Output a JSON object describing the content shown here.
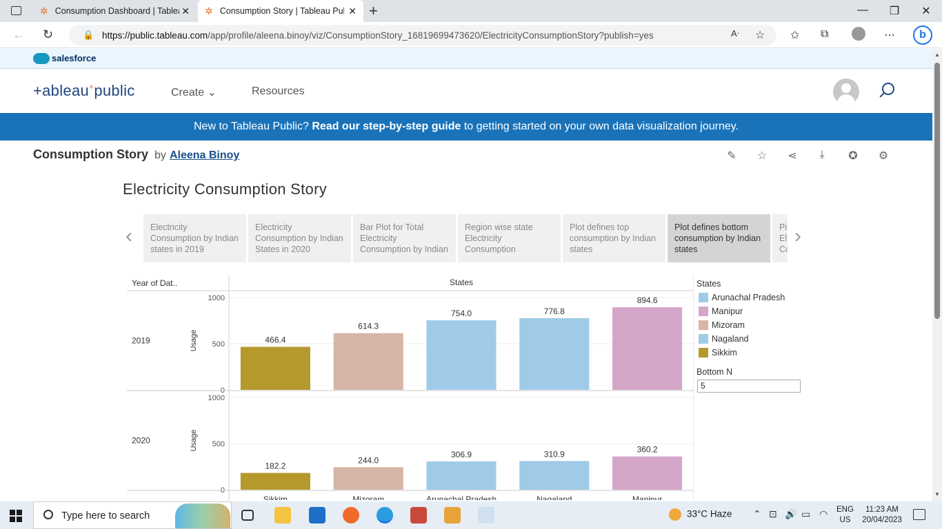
{
  "browser": {
    "tabs": [
      {
        "title": "Consumption Dashboard | Tablea"
      },
      {
        "title": "Consumption Story | Tableau Pub"
      }
    ],
    "new_tab": "+",
    "url_domain": "https://public.tableau.com",
    "url_path": "/app/profile/aleena.binoy/viz/ConsumptionStory_16819699473620/ElectricityConsumptionStory?publish=yes",
    "minimize": "—",
    "restore": "❐",
    "close": "✕"
  },
  "salesforce": {
    "label": "salesforce"
  },
  "header": {
    "logo_a": "+ableau",
    "logo_plus": "+",
    "logo_b": "public",
    "nav": [
      {
        "label": "Create ⌄"
      },
      {
        "label": "Resources"
      }
    ]
  },
  "banner": {
    "pre": "New to Tableau Public? ",
    "bold": "Read our step-by-step guide",
    "post": " to getting started on your own data visualization journey."
  },
  "viz": {
    "title": "Consumption Story",
    "by": "by",
    "author": "Aleena Binoy",
    "story_title": "Electricity Consumption Story"
  },
  "story_points": [
    {
      "label": "Electricity Consumption by Indian states in 2019"
    },
    {
      "label": "Electricity Consumption by Indian States in 2020"
    },
    {
      "label": "Bar Plot for Total Electricity Consumption by Indian"
    },
    {
      "label": "Region wise state Electricity Consumption"
    },
    {
      "label": "Plot defines top consumption by Indian states"
    },
    {
      "label": "Plot defines bottom consumption by Indian states"
    },
    {
      "label": "Pi El Co"
    }
  ],
  "chart_data": {
    "type": "bar",
    "title": "",
    "row_header": "Year of Dat..",
    "column_header": "States",
    "ylabel": "Usage",
    "ylim": [
      0,
      1000
    ],
    "yticks": [
      0,
      500,
      1000
    ],
    "panels": [
      {
        "year": "2019",
        "categories": [
          "Sikkim",
          "Mizoram",
          "Arunachal Pradesh",
          "Nagaland",
          "Manipur"
        ],
        "values": [
          466.4,
          614.3,
          754.0,
          776.8,
          894.6
        ],
        "labels": [
          "466.4",
          "614.3",
          "754.0",
          "776.8",
          "894.6"
        ]
      },
      {
        "year": "2020",
        "categories": [
          "Sikkim",
          "Mizoram",
          "Arunachal Pradesh",
          "Nagaland",
          "Manipur"
        ],
        "values": [
          182.2,
          244.0,
          306.9,
          310.9,
          360.2
        ],
        "labels": [
          "182.2",
          "244.0",
          "306.9",
          "310.9",
          "360.2"
        ]
      }
    ],
    "x_tick_labels": [
      "Sikkim",
      "Mizoram",
      "Arunachal Pradesh",
      "Nagaland",
      "Manipur"
    ],
    "colors": {
      "Arunachal Pradesh": "#a0cbe8",
      "Manipur": "#d4a6c8",
      "Mizoram": "#d7b5a6",
      "Nagaland": "#a0cbe8",
      "Sikkim": "#b6992d"
    },
    "legend": {
      "title": "States",
      "placement": "right",
      "entries": [
        "Arunachal Pradesh",
        "Manipur",
        "Mizoram",
        "Nagaland",
        "Sikkim"
      ]
    },
    "grid": true
  },
  "parameter": {
    "label": "Bottom N",
    "value": "5"
  },
  "taskbar": {
    "search_placeholder": "Type here to search",
    "weather": "33°C  Haze",
    "lang_top": "ENG",
    "lang_bottom": "US",
    "time": "11:23 AM",
    "date": "20/04/2023"
  }
}
